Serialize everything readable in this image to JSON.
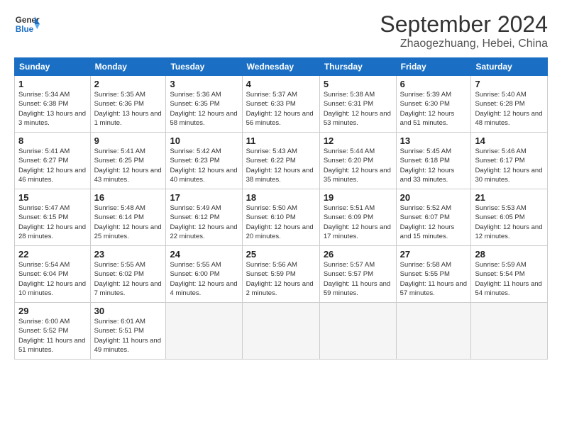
{
  "header": {
    "logo_line1": "General",
    "logo_line2": "Blue",
    "month_title": "September 2024",
    "subtitle": "Zhaogezhuang, Hebei, China"
  },
  "weekdays": [
    "Sunday",
    "Monday",
    "Tuesday",
    "Wednesday",
    "Thursday",
    "Friday",
    "Saturday"
  ],
  "weeks": [
    [
      {
        "day": "1",
        "info": "Sunrise: 5:34 AM\nSunset: 6:38 PM\nDaylight: 13 hours\nand 3 minutes."
      },
      {
        "day": "2",
        "info": "Sunrise: 5:35 AM\nSunset: 6:36 PM\nDaylight: 13 hours\nand 1 minute."
      },
      {
        "day": "3",
        "info": "Sunrise: 5:36 AM\nSunset: 6:35 PM\nDaylight: 12 hours\nand 58 minutes."
      },
      {
        "day": "4",
        "info": "Sunrise: 5:37 AM\nSunset: 6:33 PM\nDaylight: 12 hours\nand 56 minutes."
      },
      {
        "day": "5",
        "info": "Sunrise: 5:38 AM\nSunset: 6:31 PM\nDaylight: 12 hours\nand 53 minutes."
      },
      {
        "day": "6",
        "info": "Sunrise: 5:39 AM\nSunset: 6:30 PM\nDaylight: 12 hours\nand 51 minutes."
      },
      {
        "day": "7",
        "info": "Sunrise: 5:40 AM\nSunset: 6:28 PM\nDaylight: 12 hours\nand 48 minutes."
      }
    ],
    [
      {
        "day": "8",
        "info": "Sunrise: 5:41 AM\nSunset: 6:27 PM\nDaylight: 12 hours\nand 46 minutes."
      },
      {
        "day": "9",
        "info": "Sunrise: 5:41 AM\nSunset: 6:25 PM\nDaylight: 12 hours\nand 43 minutes."
      },
      {
        "day": "10",
        "info": "Sunrise: 5:42 AM\nSunset: 6:23 PM\nDaylight: 12 hours\nand 40 minutes."
      },
      {
        "day": "11",
        "info": "Sunrise: 5:43 AM\nSunset: 6:22 PM\nDaylight: 12 hours\nand 38 minutes."
      },
      {
        "day": "12",
        "info": "Sunrise: 5:44 AM\nSunset: 6:20 PM\nDaylight: 12 hours\nand 35 minutes."
      },
      {
        "day": "13",
        "info": "Sunrise: 5:45 AM\nSunset: 6:18 PM\nDaylight: 12 hours\nand 33 minutes."
      },
      {
        "day": "14",
        "info": "Sunrise: 5:46 AM\nSunset: 6:17 PM\nDaylight: 12 hours\nand 30 minutes."
      }
    ],
    [
      {
        "day": "15",
        "info": "Sunrise: 5:47 AM\nSunset: 6:15 PM\nDaylight: 12 hours\nand 28 minutes."
      },
      {
        "day": "16",
        "info": "Sunrise: 5:48 AM\nSunset: 6:14 PM\nDaylight: 12 hours\nand 25 minutes."
      },
      {
        "day": "17",
        "info": "Sunrise: 5:49 AM\nSunset: 6:12 PM\nDaylight: 12 hours\nand 22 minutes."
      },
      {
        "day": "18",
        "info": "Sunrise: 5:50 AM\nSunset: 6:10 PM\nDaylight: 12 hours\nand 20 minutes."
      },
      {
        "day": "19",
        "info": "Sunrise: 5:51 AM\nSunset: 6:09 PM\nDaylight: 12 hours\nand 17 minutes."
      },
      {
        "day": "20",
        "info": "Sunrise: 5:52 AM\nSunset: 6:07 PM\nDaylight: 12 hours\nand 15 minutes."
      },
      {
        "day": "21",
        "info": "Sunrise: 5:53 AM\nSunset: 6:05 PM\nDaylight: 12 hours\nand 12 minutes."
      }
    ],
    [
      {
        "day": "22",
        "info": "Sunrise: 5:54 AM\nSunset: 6:04 PM\nDaylight: 12 hours\nand 10 minutes."
      },
      {
        "day": "23",
        "info": "Sunrise: 5:55 AM\nSunset: 6:02 PM\nDaylight: 12 hours\nand 7 minutes."
      },
      {
        "day": "24",
        "info": "Sunrise: 5:55 AM\nSunset: 6:00 PM\nDaylight: 12 hours\nand 4 minutes."
      },
      {
        "day": "25",
        "info": "Sunrise: 5:56 AM\nSunset: 5:59 PM\nDaylight: 12 hours\nand 2 minutes."
      },
      {
        "day": "26",
        "info": "Sunrise: 5:57 AM\nSunset: 5:57 PM\nDaylight: 11 hours\nand 59 minutes."
      },
      {
        "day": "27",
        "info": "Sunrise: 5:58 AM\nSunset: 5:55 PM\nDaylight: 11 hours\nand 57 minutes."
      },
      {
        "day": "28",
        "info": "Sunrise: 5:59 AM\nSunset: 5:54 PM\nDaylight: 11 hours\nand 54 minutes."
      }
    ],
    [
      {
        "day": "29",
        "info": "Sunrise: 6:00 AM\nSunset: 5:52 PM\nDaylight: 11 hours\nand 51 minutes."
      },
      {
        "day": "30",
        "info": "Sunrise: 6:01 AM\nSunset: 5:51 PM\nDaylight: 11 hours\nand 49 minutes."
      },
      {
        "day": "",
        "info": ""
      },
      {
        "day": "",
        "info": ""
      },
      {
        "day": "",
        "info": ""
      },
      {
        "day": "",
        "info": ""
      },
      {
        "day": "",
        "info": ""
      }
    ]
  ]
}
